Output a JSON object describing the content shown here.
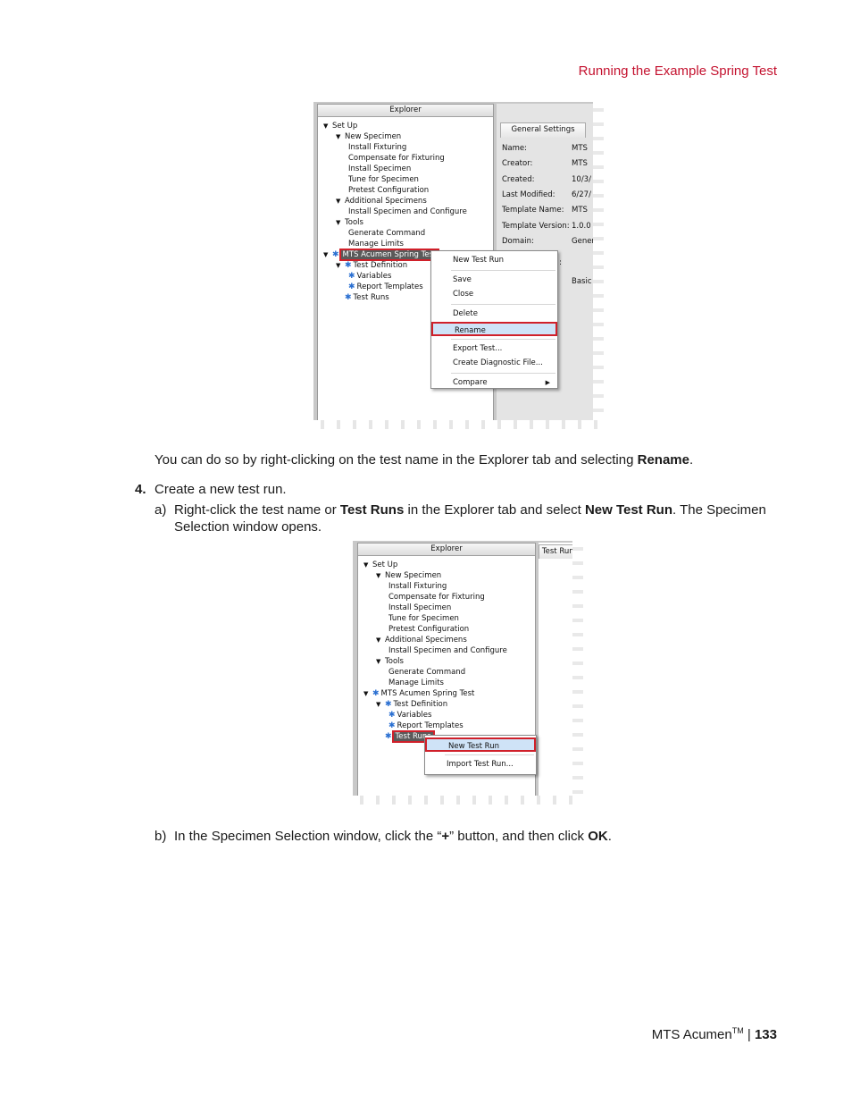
{
  "header": {
    "title": "Running the Example Spring Test"
  },
  "shot1": {
    "explorer_title": "Explorer",
    "tree": [
      {
        "label": "Set Up",
        "level": 0,
        "tri": true
      },
      {
        "label": "New Specimen",
        "level": 1,
        "tri": true
      },
      {
        "label": "Install Fixturing",
        "level": 2
      },
      {
        "label": "Compensate for Fixturing",
        "level": 2
      },
      {
        "label": "Install Specimen",
        "level": 2
      },
      {
        "label": "Tune for Specimen",
        "level": 2
      },
      {
        "label": "Pretest Configuration",
        "level": 2
      },
      {
        "label": "Additional Specimens",
        "level": 1,
        "tri": true
      },
      {
        "label": "Install Specimen and Configure",
        "level": 2
      },
      {
        "label": "Tools",
        "level": 1,
        "tri": true
      },
      {
        "label": "Generate Command",
        "level": 2
      },
      {
        "label": "Manage Limits",
        "level": 2
      },
      {
        "label": "MTS Acumen Spring Test",
        "level": 0,
        "tri": true,
        "star": true,
        "highlight": true
      },
      {
        "label": "Test Definition",
        "level": 1,
        "tri": true,
        "star": true
      },
      {
        "label": "Variables",
        "level": 2,
        "star": true
      },
      {
        "label": "Report Templates",
        "level": 2,
        "star": true
      },
      {
        "label": "Test Runs",
        "level": 1,
        "star": true
      }
    ],
    "settings_tab": "General Settings",
    "settings": [
      {
        "key": "Name:",
        "value": "MTS"
      },
      {
        "key": "Creator:",
        "value": "MTS"
      },
      {
        "key": "Created:",
        "value": "10/3/"
      },
      {
        "key": "Last Modified:",
        "value": "6/27/"
      },
      {
        "key": "Template Name:",
        "value": "MTS"
      },
      {
        "key": "Template Version:",
        "value": "1.0.0"
      },
      {
        "key": "Domain:",
        "value": "Generic"
      }
    ],
    "settings_extra": [
      ":",
      "Basic"
    ],
    "context_menu": [
      {
        "label": "New Test Run"
      },
      {
        "sep": true
      },
      {
        "label": "Save"
      },
      {
        "label": "Close"
      },
      {
        "sep": true
      },
      {
        "label": "Delete"
      },
      {
        "label": "Rename",
        "selected": true
      },
      {
        "sep": true
      },
      {
        "label": "Export Test..."
      },
      {
        "label": "Create Diagnostic File..."
      },
      {
        "sep": true
      },
      {
        "label": "Compare",
        "submenu": true
      }
    ]
  },
  "para1": {
    "text_a": "You can do so by right-clicking on the test name in the Explorer tab and selecting ",
    "bold_a": "Rename",
    "text_b": "."
  },
  "step4": {
    "num": "4.",
    "text": "Create a new test run."
  },
  "step4a": {
    "marker": "a)",
    "t1": "Right-click the test name or ",
    "b1": "Test Runs",
    "t2": " in the Explorer tab and select ",
    "b2": "New Test Run",
    "t3": ". The Specimen",
    "t4": "Selection window opens."
  },
  "shot2": {
    "explorer_title": "Explorer",
    "right_tab": "Test Runs",
    "tree": [
      {
        "label": "Set Up",
        "level": 0,
        "tri": true
      },
      {
        "label": "New Specimen",
        "level": 1,
        "tri": true
      },
      {
        "label": "Install Fixturing",
        "level": 2
      },
      {
        "label": "Compensate for Fixturing",
        "level": 2
      },
      {
        "label": "Install Specimen",
        "level": 2
      },
      {
        "label": "Tune for Specimen",
        "level": 2
      },
      {
        "label": "Pretest Configuration",
        "level": 2
      },
      {
        "label": "Additional Specimens",
        "level": 1,
        "tri": true
      },
      {
        "label": "Install Specimen and Configure",
        "level": 2
      },
      {
        "label": "Tools",
        "level": 1,
        "tri": true
      },
      {
        "label": "Generate Command",
        "level": 2
      },
      {
        "label": "Manage Limits",
        "level": 2
      },
      {
        "label": "MTS Acumen Spring Test",
        "level": 0,
        "tri": true,
        "star": true
      },
      {
        "label": "Test Definition",
        "level": 1,
        "tri": true,
        "star": true
      },
      {
        "label": "Variables",
        "level": 2,
        "star": true
      },
      {
        "label": "Report Templates",
        "level": 2,
        "star": true
      },
      {
        "label": "Test Runs",
        "level": 1,
        "star": true,
        "highlight": true
      }
    ],
    "context_menu": [
      {
        "label": "New Test Run",
        "selected": true
      },
      {
        "sep": true
      },
      {
        "label": "Import Test Run..."
      }
    ]
  },
  "step4b": {
    "marker": "b)",
    "t1": "In the Specimen Selection window, click the “",
    "b1": "+",
    "t2": "” button, and then click ",
    "b2": "OK",
    "t3": "."
  },
  "footer": {
    "product": "MTS Acumen",
    "tm": "TM",
    "sep": " | ",
    "page": "133"
  }
}
